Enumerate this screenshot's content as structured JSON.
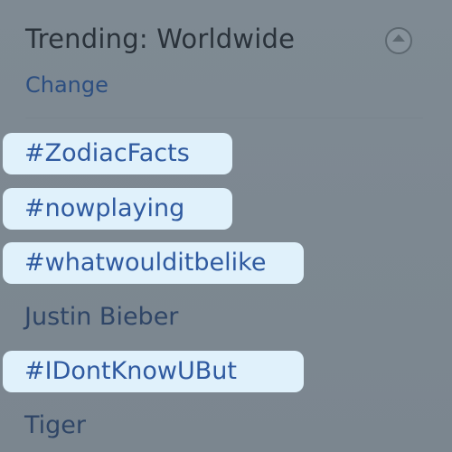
{
  "panel": {
    "title": "Trending: Worldwide",
    "change_label": "Change",
    "collapse_icon": "collapse-up-icon"
  },
  "trends": [
    {
      "label": "#ZodiacFacts",
      "highlighted": true
    },
    {
      "label": "#nowplaying",
      "highlighted": true
    },
    {
      "label": "#whatwoulditbelike",
      "highlighted": true
    },
    {
      "label": "Justin Bieber",
      "highlighted": false
    },
    {
      "label": "#IDontKnowUBut",
      "highlighted": true
    },
    {
      "label": "Tiger",
      "highlighted": false
    }
  ],
  "colors": {
    "background": "#7d8891",
    "highlight": "#e0f1fb",
    "link": "#2f5aa0",
    "title": "#2a323a"
  }
}
